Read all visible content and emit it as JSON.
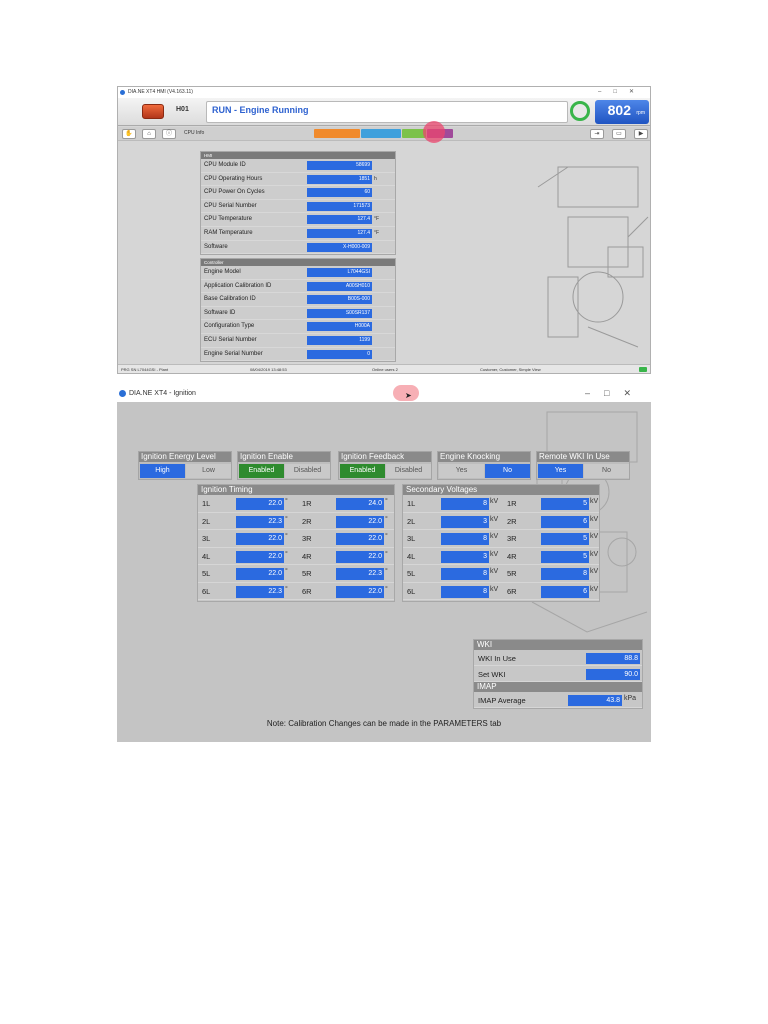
{
  "window1": {
    "title": "DIA.NE XT4 HMI (V4.163.11)",
    "unit_label": "H01",
    "status": "RUN - Engine Running",
    "rpm_value": "802",
    "rpm_unit": "rpm",
    "toolbar_label": "CPU Info",
    "tabs": [
      "",
      "",
      "",
      ""
    ],
    "panel_cpu": {
      "title": "HMI",
      "rows": [
        {
          "label": "CPU Module ID",
          "value": "58699",
          "unit": ""
        },
        {
          "label": "CPU Operating Hours",
          "value": "1851",
          "unit": "h"
        },
        {
          "label": "CPU Power On Cycles",
          "value": "60",
          "unit": ""
        },
        {
          "label": "CPU Serial Number",
          "value": "171573",
          "unit": ""
        },
        {
          "label": "CPU Temperature",
          "value": "127.4",
          "unit": "°F"
        },
        {
          "label": "RAM Temperature",
          "value": "127.4",
          "unit": "°F"
        },
        {
          "label": "Software",
          "value": "X-H000-009",
          "unit": ""
        }
      ]
    },
    "panel_controller": {
      "title": "Controller",
      "rows": [
        {
          "label": "Engine Model",
          "value": "L7044GSI",
          "unit": ""
        },
        {
          "label": "Application Calibration ID",
          "value": "A00SH010",
          "unit": ""
        },
        {
          "label": "Base Calibration ID",
          "value": "B00S-000",
          "unit": ""
        },
        {
          "label": "Software ID",
          "value": "S00SR137",
          "unit": ""
        },
        {
          "label": "Configuration Type",
          "value": "H000A",
          "unit": ""
        },
        {
          "label": "ECU Serial Number",
          "value": "1199",
          "unit": ""
        },
        {
          "label": "Engine Serial Number",
          "value": "0",
          "unit": ""
        }
      ]
    },
    "statusbar": {
      "left": "PRG SN L7044GSI - Plant",
      "center": "08/04/2019 13:48:53",
      "users": "Online users 2",
      "right": "Customer, Customer, Simple View"
    }
  },
  "window2": {
    "title": "DIA.NE XT4 - Ignition",
    "groups": [
      {
        "title": "Ignition Energy Level",
        "opt_left": "High",
        "opt_right": "Low",
        "active": "left",
        "color": "blue"
      },
      {
        "title": "Ignition Enable",
        "opt_left": "Enabled",
        "opt_right": "Disabled",
        "active": "left",
        "color": "green"
      },
      {
        "title": "Ignition Feedback",
        "opt_left": "Enabled",
        "opt_right": "Disabled",
        "active": "left",
        "color": "green"
      },
      {
        "title": "Engine Knocking",
        "opt_left": "Yes",
        "opt_right": "No",
        "active": "right",
        "color": "blue"
      },
      {
        "title": "Remote WKI In Use",
        "opt_left": "Yes",
        "opt_right": "No",
        "active": "left",
        "color": "blue"
      }
    ],
    "timing": {
      "title": "Ignition Timing",
      "unit": "°",
      "rows": [
        {
          "l": "1L",
          "lv": "22.0",
          "r": "1R",
          "rv": "24.0"
        },
        {
          "l": "2L",
          "lv": "22.3",
          "r": "2R",
          "rv": "22.0"
        },
        {
          "l": "3L",
          "lv": "22.0",
          "r": "3R",
          "rv": "22.0"
        },
        {
          "l": "4L",
          "lv": "22.0",
          "r": "4R",
          "rv": "22.0"
        },
        {
          "l": "5L",
          "lv": "22.0",
          "r": "5R",
          "rv": "22.3"
        },
        {
          "l": "6L",
          "lv": "22.3",
          "r": "6R",
          "rv": "22.0"
        }
      ]
    },
    "voltages": {
      "title": "Secondary Voltages",
      "unit": "kV",
      "rows": [
        {
          "l": "1L",
          "lv": "8",
          "r": "1R",
          "rv": "5"
        },
        {
          "l": "2L",
          "lv": "3",
          "r": "2R",
          "rv": "6"
        },
        {
          "l": "3L",
          "lv": "8",
          "r": "3R",
          "rv": "5"
        },
        {
          "l": "4L",
          "lv": "3",
          "r": "4R",
          "rv": "5"
        },
        {
          "l": "5L",
          "lv": "8",
          "r": "5R",
          "rv": "8"
        },
        {
          "l": "6L",
          "lv": "8",
          "r": "6R",
          "rv": "6"
        }
      ]
    },
    "wki": {
      "title": "WKI",
      "in_use_label": "WKI In Use",
      "in_use_value": "88.8",
      "set_label": "Set WKI",
      "set_value": "90.0"
    },
    "imap": {
      "title": "IMAP",
      "avg_label": "IMAP Average",
      "avg_value": "43.8",
      "avg_unit": "kPa"
    },
    "note": "Note: Calibration Changes can be made in the PARAMETERS tab"
  },
  "colors": {
    "value_blue": "#2b6ae0",
    "active_green": "#2e8b2e",
    "panel_gray": "#c7c7c7",
    "status_text": "#2e62d0"
  }
}
